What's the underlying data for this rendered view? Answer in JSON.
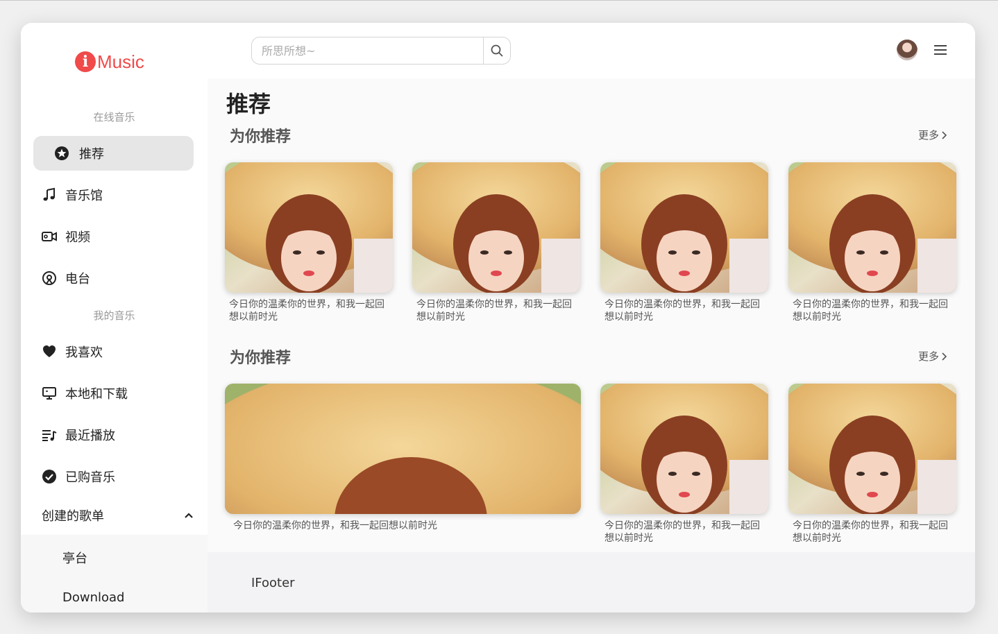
{
  "app": {
    "logo_letter": "i",
    "logo_text": "Music",
    "brand_color": "#f04a4a"
  },
  "sidebar": {
    "online_section": "在线音乐",
    "my_section": "我的音乐",
    "items": [
      {
        "label": "推荐",
        "icon": "star-circle-icon",
        "active": true
      },
      {
        "label": "音乐馆",
        "icon": "music-note-icon"
      },
      {
        "label": "视频",
        "icon": "video-camera-icon"
      },
      {
        "label": "电台",
        "icon": "radio-icon"
      },
      {
        "label": "我喜欢",
        "icon": "heart-icon"
      },
      {
        "label": "本地和下载",
        "icon": "monitor-icon"
      },
      {
        "label": "最近播放",
        "icon": "playlist-icon"
      },
      {
        "label": "已购音乐",
        "icon": "check-circle-icon"
      }
    ],
    "playlists_header": "创建的歌单",
    "playlists": [
      "亭台",
      "Download"
    ]
  },
  "header": {
    "search_placeholder": "所思所想~",
    "search_icon": "search-icon",
    "avatar_icon": "avatar",
    "menu_icon": "hamburger-menu-icon"
  },
  "main": {
    "title": "推荐",
    "sections": [
      {
        "title": "为你推荐",
        "more": "更多",
        "cards": [
          {
            "caption": "今日你的温柔你的世界，和我一起回想以前时光"
          },
          {
            "caption": "今日你的温柔你的世界，和我一起回想以前时光"
          },
          {
            "caption": "今日你的温柔你的世界，和我一起回想以前时光"
          },
          {
            "caption": "今日你的温柔你的世界，和我一起回想以前时光"
          }
        ]
      },
      {
        "title": "为你推荐",
        "more": "更多",
        "cards": [
          {
            "caption": "今日你的温柔你的世界，和我一起回想以前时光"
          },
          {
            "caption": "今日你的温柔你的世界，和我一起回想以前时光"
          },
          {
            "caption": "今日你的温柔你的世界，和我一起回想以前时光"
          }
        ]
      }
    ]
  },
  "footer": {
    "text": "IFooter"
  }
}
